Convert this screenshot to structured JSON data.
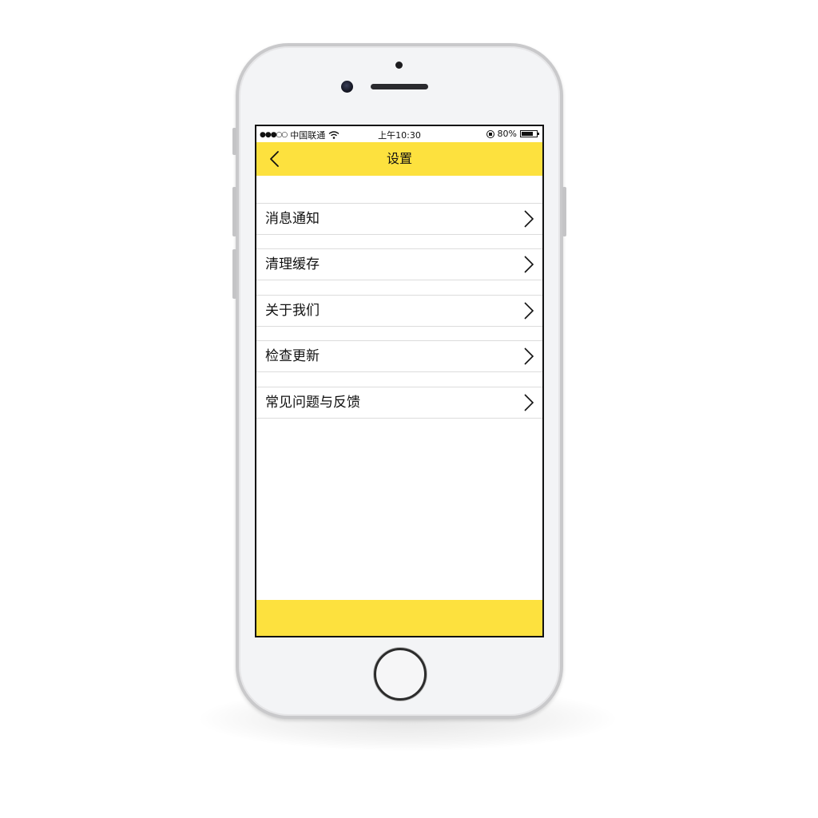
{
  "status_bar": {
    "carrier": "中国联通",
    "time": "上午10:30",
    "battery": "80%",
    "battery_level": 0.8
  },
  "header": {
    "title": "设置",
    "back_icon": "chevron-left-icon"
  },
  "settings": {
    "items": [
      {
        "label": "消息通知"
      },
      {
        "label": "清理缓存"
      },
      {
        "label": "关于我们"
      },
      {
        "label": "检查更新"
      },
      {
        "label": "常见问题与反馈"
      }
    ]
  },
  "colors": {
    "accent": "#fde13e",
    "phone_frame": "#f3f4f6"
  }
}
